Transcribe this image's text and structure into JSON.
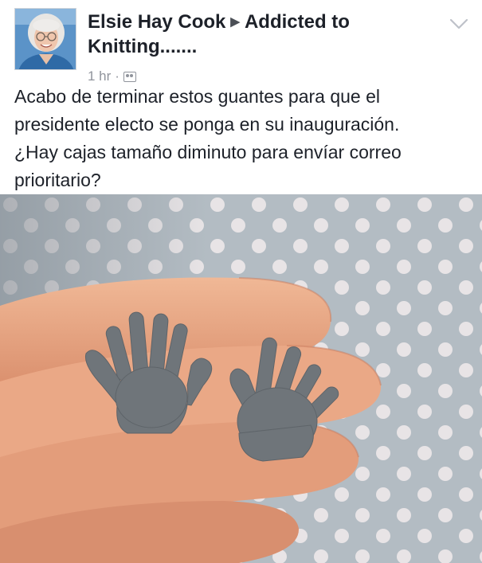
{
  "post": {
    "author": "Elsie Hay Cook",
    "group": "Addicted to Knitting.......",
    "timestamp": "1 hr",
    "separator": "·",
    "audience_icon": "group-icon",
    "menu_icon": "chevron-down-icon",
    "text": "Acabo de terminar estos guantes para que el\npresidente electo se ponga en su inauguración.\n¿Hay cajas tamaño diminuto para envíar correo\nprioritario?",
    "photo_icon": "knitted-gloves-photo"
  },
  "colors": {
    "text": "#1d2129",
    "meta": "#90949c",
    "tablecloth": "#b3bcc3",
    "glove": "#6f757a",
    "skin": "#e6a37f"
  }
}
